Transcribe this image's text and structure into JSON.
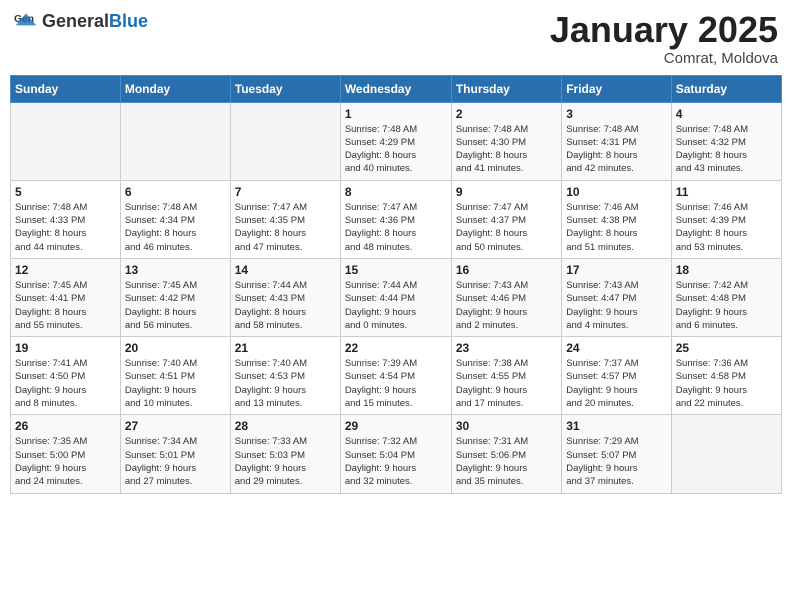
{
  "header": {
    "logo_general": "General",
    "logo_blue": "Blue",
    "month_title": "January 2025",
    "location": "Comrat, Moldova"
  },
  "days_of_week": [
    "Sunday",
    "Monday",
    "Tuesday",
    "Wednesday",
    "Thursday",
    "Friday",
    "Saturday"
  ],
  "weeks": [
    [
      {
        "day": "",
        "info": ""
      },
      {
        "day": "",
        "info": ""
      },
      {
        "day": "",
        "info": ""
      },
      {
        "day": "1",
        "info": "Sunrise: 7:48 AM\nSunset: 4:29 PM\nDaylight: 8 hours\nand 40 minutes."
      },
      {
        "day": "2",
        "info": "Sunrise: 7:48 AM\nSunset: 4:30 PM\nDaylight: 8 hours\nand 41 minutes."
      },
      {
        "day": "3",
        "info": "Sunrise: 7:48 AM\nSunset: 4:31 PM\nDaylight: 8 hours\nand 42 minutes."
      },
      {
        "day": "4",
        "info": "Sunrise: 7:48 AM\nSunset: 4:32 PM\nDaylight: 8 hours\nand 43 minutes."
      }
    ],
    [
      {
        "day": "5",
        "info": "Sunrise: 7:48 AM\nSunset: 4:33 PM\nDaylight: 8 hours\nand 44 minutes."
      },
      {
        "day": "6",
        "info": "Sunrise: 7:48 AM\nSunset: 4:34 PM\nDaylight: 8 hours\nand 46 minutes."
      },
      {
        "day": "7",
        "info": "Sunrise: 7:47 AM\nSunset: 4:35 PM\nDaylight: 8 hours\nand 47 minutes."
      },
      {
        "day": "8",
        "info": "Sunrise: 7:47 AM\nSunset: 4:36 PM\nDaylight: 8 hours\nand 48 minutes."
      },
      {
        "day": "9",
        "info": "Sunrise: 7:47 AM\nSunset: 4:37 PM\nDaylight: 8 hours\nand 50 minutes."
      },
      {
        "day": "10",
        "info": "Sunrise: 7:46 AM\nSunset: 4:38 PM\nDaylight: 8 hours\nand 51 minutes."
      },
      {
        "day": "11",
        "info": "Sunrise: 7:46 AM\nSunset: 4:39 PM\nDaylight: 8 hours\nand 53 minutes."
      }
    ],
    [
      {
        "day": "12",
        "info": "Sunrise: 7:45 AM\nSunset: 4:41 PM\nDaylight: 8 hours\nand 55 minutes."
      },
      {
        "day": "13",
        "info": "Sunrise: 7:45 AM\nSunset: 4:42 PM\nDaylight: 8 hours\nand 56 minutes."
      },
      {
        "day": "14",
        "info": "Sunrise: 7:44 AM\nSunset: 4:43 PM\nDaylight: 8 hours\nand 58 minutes."
      },
      {
        "day": "15",
        "info": "Sunrise: 7:44 AM\nSunset: 4:44 PM\nDaylight: 9 hours\nand 0 minutes."
      },
      {
        "day": "16",
        "info": "Sunrise: 7:43 AM\nSunset: 4:46 PM\nDaylight: 9 hours\nand 2 minutes."
      },
      {
        "day": "17",
        "info": "Sunrise: 7:43 AM\nSunset: 4:47 PM\nDaylight: 9 hours\nand 4 minutes."
      },
      {
        "day": "18",
        "info": "Sunrise: 7:42 AM\nSunset: 4:48 PM\nDaylight: 9 hours\nand 6 minutes."
      }
    ],
    [
      {
        "day": "19",
        "info": "Sunrise: 7:41 AM\nSunset: 4:50 PM\nDaylight: 9 hours\nand 8 minutes."
      },
      {
        "day": "20",
        "info": "Sunrise: 7:40 AM\nSunset: 4:51 PM\nDaylight: 9 hours\nand 10 minutes."
      },
      {
        "day": "21",
        "info": "Sunrise: 7:40 AM\nSunset: 4:53 PM\nDaylight: 9 hours\nand 13 minutes."
      },
      {
        "day": "22",
        "info": "Sunrise: 7:39 AM\nSunset: 4:54 PM\nDaylight: 9 hours\nand 15 minutes."
      },
      {
        "day": "23",
        "info": "Sunrise: 7:38 AM\nSunset: 4:55 PM\nDaylight: 9 hours\nand 17 minutes."
      },
      {
        "day": "24",
        "info": "Sunrise: 7:37 AM\nSunset: 4:57 PM\nDaylight: 9 hours\nand 20 minutes."
      },
      {
        "day": "25",
        "info": "Sunrise: 7:36 AM\nSunset: 4:58 PM\nDaylight: 9 hours\nand 22 minutes."
      }
    ],
    [
      {
        "day": "26",
        "info": "Sunrise: 7:35 AM\nSunset: 5:00 PM\nDaylight: 9 hours\nand 24 minutes."
      },
      {
        "day": "27",
        "info": "Sunrise: 7:34 AM\nSunset: 5:01 PM\nDaylight: 9 hours\nand 27 minutes."
      },
      {
        "day": "28",
        "info": "Sunrise: 7:33 AM\nSunset: 5:03 PM\nDaylight: 9 hours\nand 29 minutes."
      },
      {
        "day": "29",
        "info": "Sunrise: 7:32 AM\nSunset: 5:04 PM\nDaylight: 9 hours\nand 32 minutes."
      },
      {
        "day": "30",
        "info": "Sunrise: 7:31 AM\nSunset: 5:06 PM\nDaylight: 9 hours\nand 35 minutes."
      },
      {
        "day": "31",
        "info": "Sunrise: 7:29 AM\nSunset: 5:07 PM\nDaylight: 9 hours\nand 37 minutes."
      },
      {
        "day": "",
        "info": ""
      }
    ]
  ]
}
